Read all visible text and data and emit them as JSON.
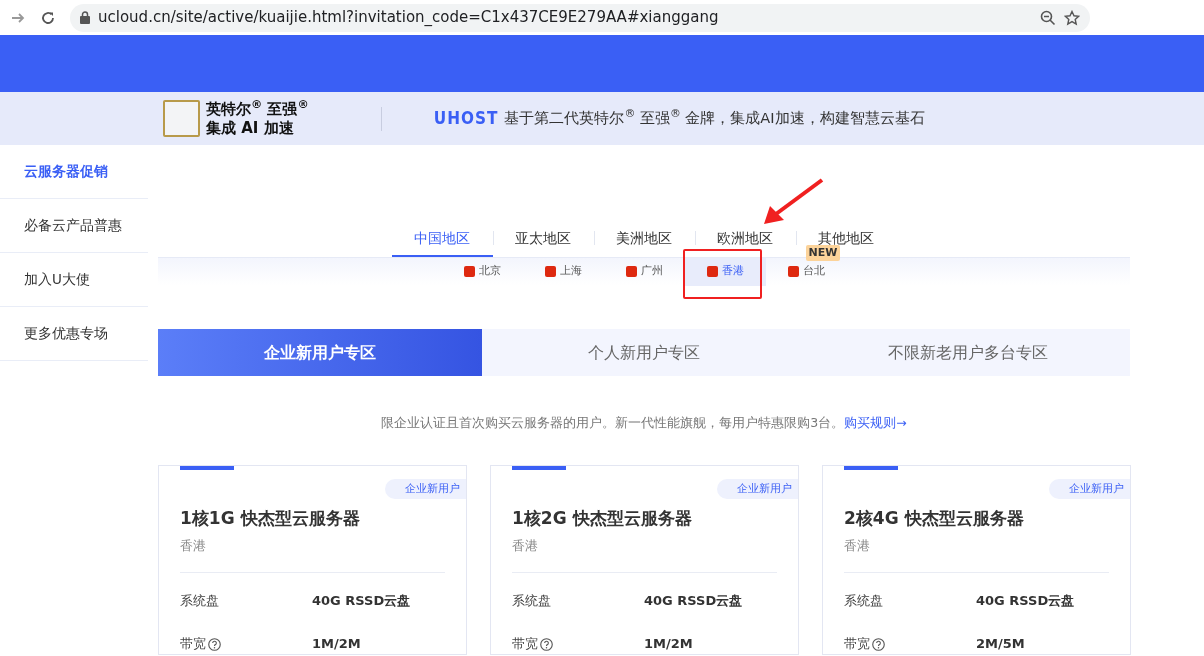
{
  "browser": {
    "url": "ucloud.cn/site/active/kuaijie.html?invitation_code=C1x437CE9E279AA#xianggang"
  },
  "promo_strip": {
    "logo_lines": [
      "英特尔$^{®}$ 至强$^{®}$",
      "集成 AI 加速"
    ],
    "product": "UHOST",
    "tagline": "基于第二代英特尔$^{®}$ 至强$^{®}$ 金牌，集成AI加速，构建智慧云基石"
  },
  "sidebar": {
    "items": [
      {
        "label": "云服务器促销",
        "selected": true
      },
      {
        "label": "必备云产品普惠",
        "selected": false
      },
      {
        "label": "加入U大使",
        "selected": false
      },
      {
        "label": "更多优惠专场",
        "selected": false
      }
    ]
  },
  "region_tabs": [
    {
      "label": "中国地区",
      "selected": true
    },
    {
      "label": "亚太地区",
      "selected": false
    },
    {
      "label": "美洲地区",
      "selected": false
    },
    {
      "label": "欧洲地区",
      "selected": false
    },
    {
      "label": "其他地区",
      "selected": false
    }
  ],
  "city_tabs": [
    {
      "label": "北京",
      "selected": false
    },
    {
      "label": "上海",
      "selected": false
    },
    {
      "label": "广州",
      "selected": false
    },
    {
      "label": "香港",
      "selected": true
    },
    {
      "label": "台北",
      "selected": false,
      "badge": "NEW"
    }
  ],
  "user_tabs": [
    {
      "label": "企业新用户专区",
      "selected": true
    },
    {
      "label": "个人新用户专区",
      "selected": false
    },
    {
      "label": "不限新老用户多台专区",
      "selected": false
    }
  ],
  "notice": {
    "text": "限企业认证且首次购买云服务器的用户。新一代性能旗舰，每用户特惠限购3台。",
    "link": "购买规则→"
  },
  "products": [
    {
      "tag": "企业新用户",
      "title": "1核1G 快杰型云服务器",
      "region": "香港",
      "specs": [
        {
          "label": "系统盘",
          "value": "40G RSSD云盘",
          "help": false
        },
        {
          "label": "带宽",
          "value": "1M/2M",
          "help": true
        }
      ]
    },
    {
      "tag": "企业新用户",
      "title": "1核2G 快杰型云服务器",
      "region": "香港",
      "specs": [
        {
          "label": "系统盘",
          "value": "40G RSSD云盘",
          "help": false
        },
        {
          "label": "带宽",
          "value": "1M/2M",
          "help": true
        }
      ]
    },
    {
      "tag": "企业新用户",
      "title": "2核4G 快杰型云服务器",
      "region": "香港",
      "specs": [
        {
          "label": "系统盘",
          "value": "40G RSSD云盘",
          "help": false
        },
        {
          "label": "带宽",
          "value": "2M/5M",
          "help": true
        }
      ]
    }
  ]
}
